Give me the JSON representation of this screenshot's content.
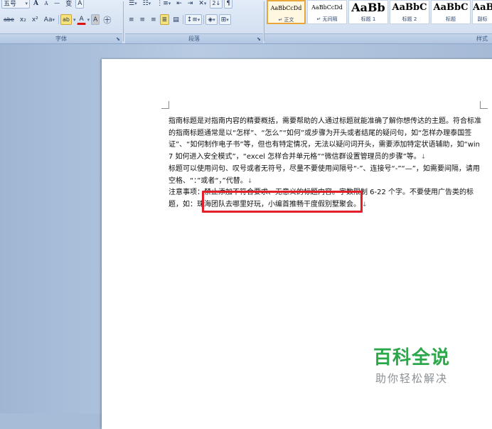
{
  "ribbon": {
    "font_group": {
      "font_size": "五号",
      "label": "字体",
      "grow_font": "A",
      "shrink_font": "A",
      "phonetic": "ᯅ",
      "char_border": "A",
      "strike_label": "abe",
      "subscript": "x₂",
      "superscript": "x²",
      "change_case": "Aa",
      "highlight": "ab",
      "font_color": "A",
      "char_shading": "A",
      "enclose_char": "㊉"
    },
    "paragraph_group": {
      "label": "段落",
      "sort": "2↓"
    },
    "styles_group": {
      "label": "样式",
      "items": [
        {
          "sample": "AaBbCcDd",
          "name": "↵ 正文",
          "active": true
        },
        {
          "sample": "AaBbCcDd",
          "name": "↵ 无间隔",
          "active": false
        },
        {
          "sample": "AaBb",
          "name": "标题 1",
          "active": false
        },
        {
          "sample": "AaBbC",
          "name": "标题 2",
          "active": false
        },
        {
          "sample": "AaBbC",
          "name": "标题",
          "active": false
        },
        {
          "sample": "AaB",
          "name": "副标",
          "active": false
        }
      ]
    }
  },
  "document": {
    "paragraph1": "指南标题是对指南内容的精要概括，需要帮助的人通过标题就能准确了解你想传达的主题。符合标准的指南标题通常是以“怎样”、“怎么”“如何”或步骤为开头或者结尾的疑问句，如“怎样办理泰国签证”、“如何制作电子书”等，但也有特定情况，无法以疑问词开头，需要添加特定状语辅助，如“win7 如何进入安全模式”，“excel 怎样合并单元格”“微信群设置管理员的步骤”等。",
    "paragraph2": "标题可以使用问句、叹号或者无符号，尽量不要使用间隔号“·”、连接号“-”“—”，如需要间隔，请用空格、“：”或者“，”代替。",
    "paragraph3_prefix": "注意事项：",
    "paragraph3_highlight": "禁止添加不符合要求、无意义的标题内容。",
    "paragraph3_suffix": "字数限制 6-22 个字。不要使用广告类的标题，如：珠海团队去哪里好玩，小编首推畅干度假别墅聚会。",
    "para_mark": "↓"
  },
  "watermark": {
    "title": "百科全说",
    "subtitle": "助你轻松解决",
    "color": "#2aa84a"
  }
}
